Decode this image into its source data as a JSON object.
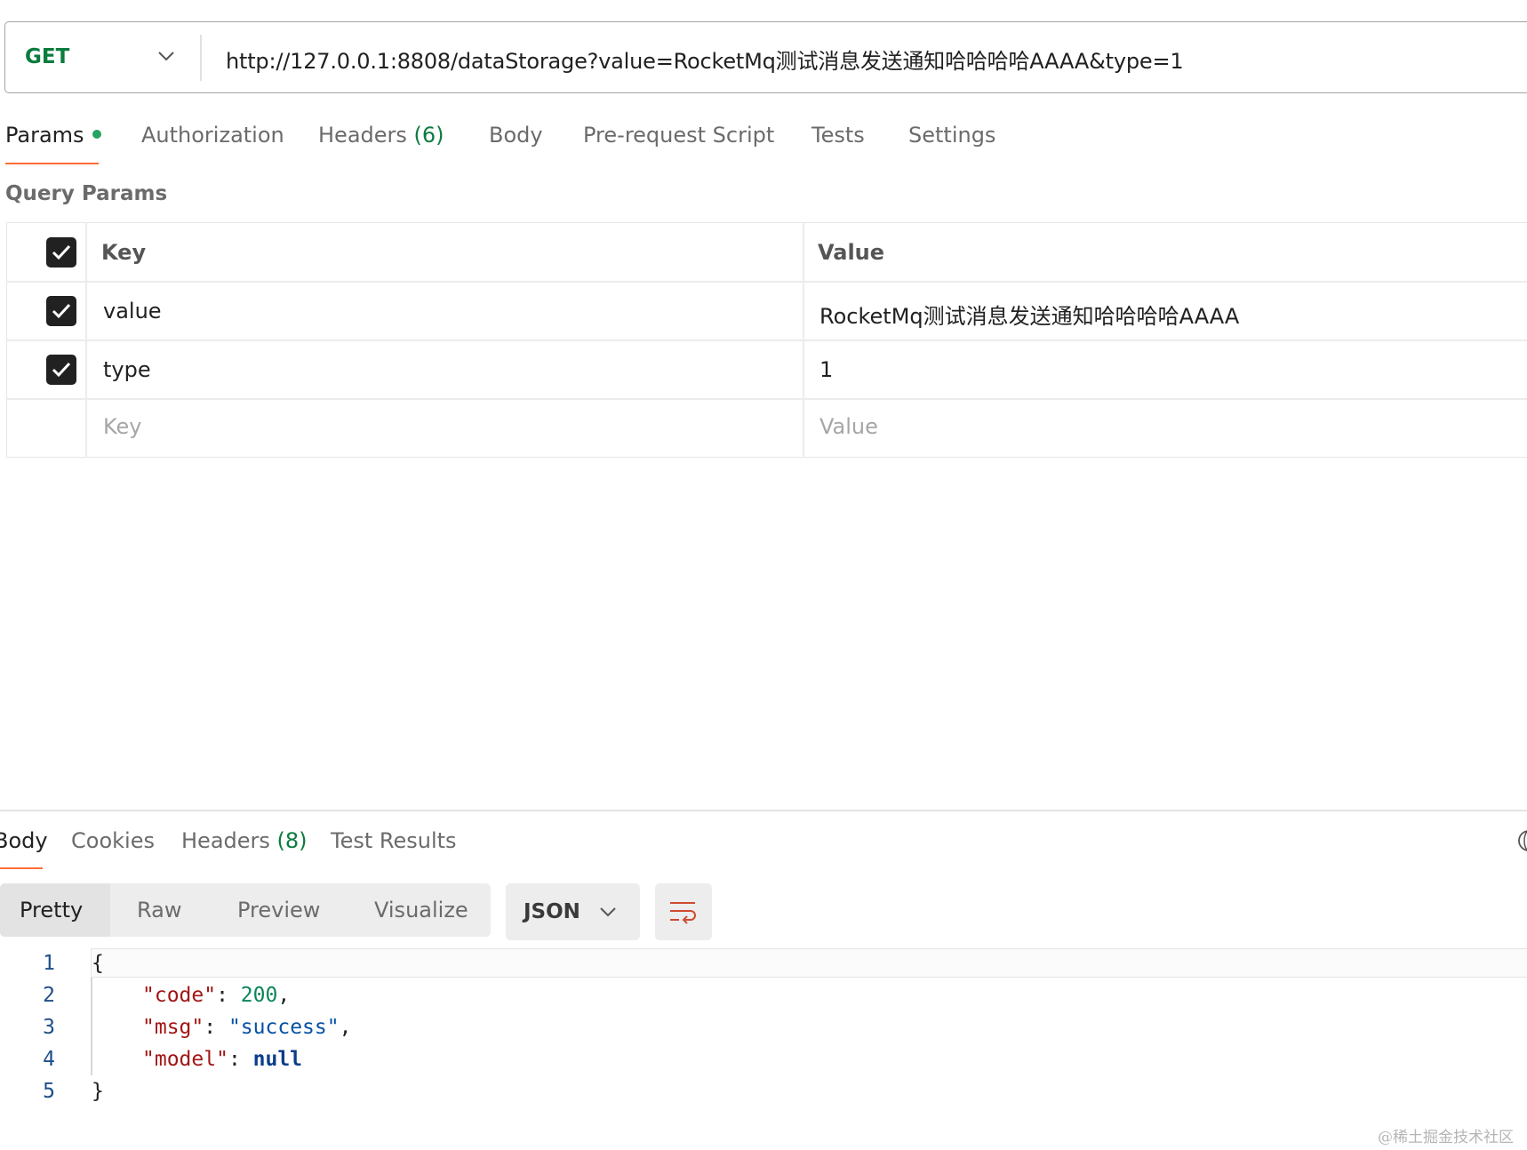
{
  "request": {
    "method": "GET",
    "url": "http://127.0.0.1:8808/dataStorage?value=RocketMq测试消息发送通知哈哈哈哈AAAA&type=1"
  },
  "request_tabs": {
    "params": "Params",
    "authorization": "Authorization",
    "headers": "Headers",
    "headers_count": "(6)",
    "body": "Body",
    "pre_request": "Pre-request Script",
    "tests": "Tests",
    "settings": "Settings"
  },
  "query_params": {
    "title": "Query Params",
    "header": {
      "key": "Key",
      "value": "Value"
    },
    "rows": [
      {
        "key": "value",
        "value": "RocketMq测试消息发送通知哈哈哈哈AAAA",
        "checked": true
      },
      {
        "key": "type",
        "value": "1",
        "checked": true
      }
    ],
    "placeholder": {
      "key": "Key",
      "value": "Value"
    }
  },
  "response_tabs": {
    "body": "Body",
    "cookies": "Cookies",
    "headers": "Headers",
    "headers_count": "(8)",
    "test_results": "Test Results"
  },
  "view_modes": {
    "pretty": "Pretty",
    "raw": "Raw",
    "preview": "Preview",
    "visualize": "Visualize"
  },
  "format": "JSON",
  "code": {
    "line_numbers": [
      "1",
      "2",
      "3",
      "4",
      "5"
    ],
    "open_brace": "{",
    "close_brace": "}",
    "code_key": "\"code\"",
    "code_value": "200",
    "msg_key": "\"msg\"",
    "msg_value": "\"success\"",
    "model_key": "\"model\"",
    "model_value": "null",
    "colon": ": ",
    "comma": ","
  },
  "watermark": "@稀土掘金技术社区",
  "colors": {
    "accent": "#ff6c37",
    "method_green": "#0b7c3e",
    "dot_green": "#25a55f"
  }
}
